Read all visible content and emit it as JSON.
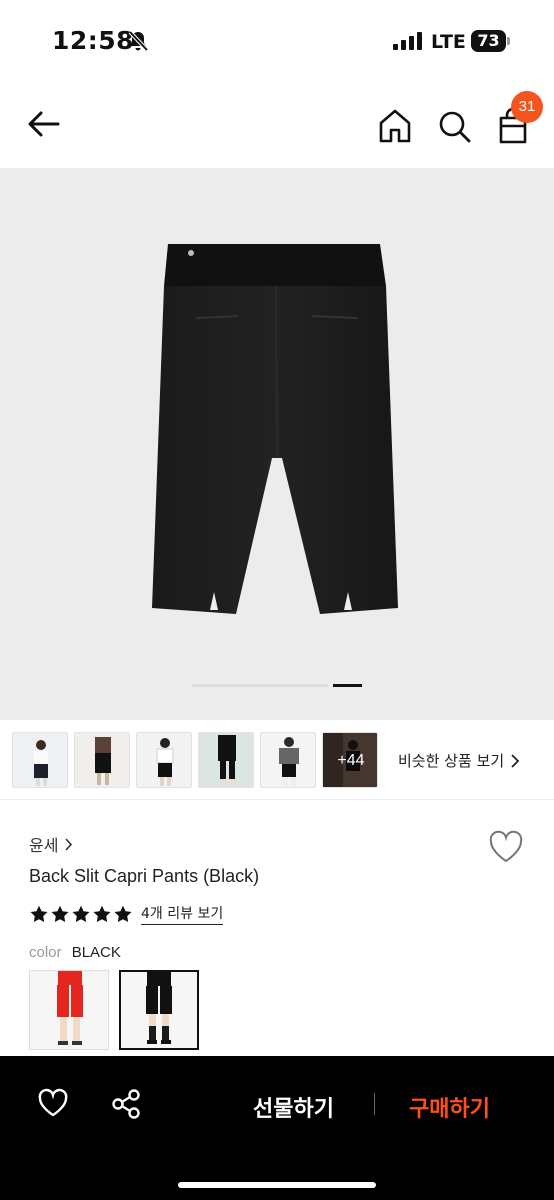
{
  "status_bar": {
    "time": "12:58",
    "network": "LTE",
    "battery": "73"
  },
  "nav": {
    "cart_badge": "31"
  },
  "gallery": {
    "more_count": "+44",
    "similar_label": "비슷한 상품 보기",
    "active_page_fraction": 1.0
  },
  "product": {
    "seller": "윤세",
    "title": "Back Slit Capri Pants (Black)",
    "rating_stars": 5,
    "review_link": "4개 리뷰 보기",
    "color_label": "color",
    "color_value": "BLACK"
  },
  "bottom_bar": {
    "gift_label": "선물하기",
    "buy_label": "구매하기"
  },
  "colors": {
    "accent": "#ff4e17",
    "badge": "#f5541e",
    "image_bg": "#ececec"
  },
  "icons": [
    "back-arrow-icon",
    "home-icon",
    "search-icon",
    "cart-icon",
    "heart-icon",
    "share-icon",
    "star-icon",
    "chevron-right-icon",
    "bell-off-icon",
    "signal-icon",
    "battery-icon"
  ]
}
